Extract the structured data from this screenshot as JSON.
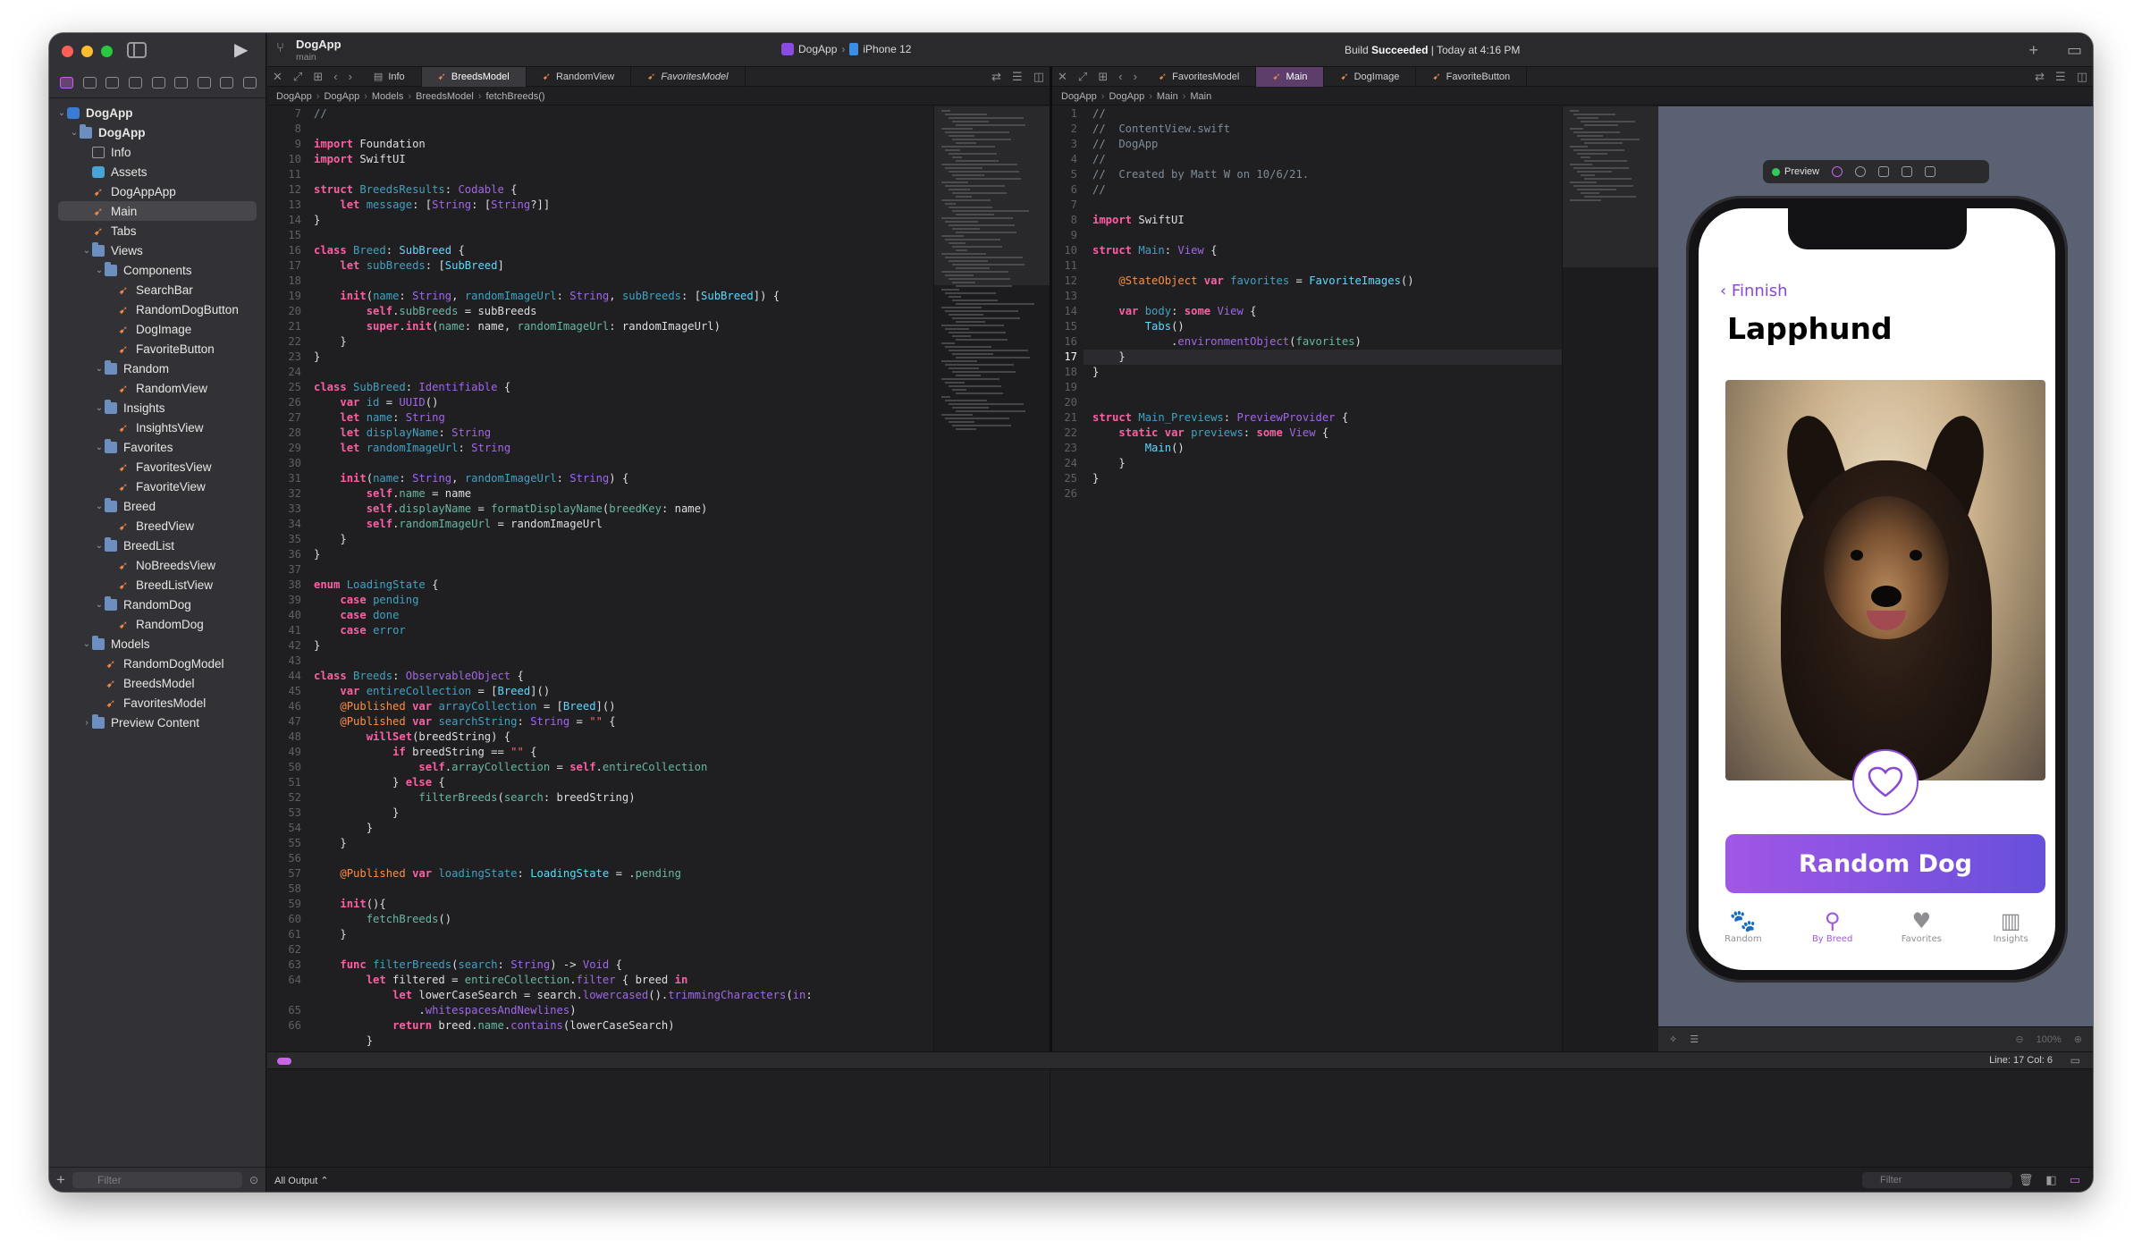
{
  "toolbar": {
    "scheme_name": "DogApp",
    "branch": "main",
    "target_app": "DogApp",
    "target_device": "iPhone 12",
    "status_prefix": "Build",
    "status_bold": "Succeeded",
    "status_suffix": "| Today at 4:16 PM"
  },
  "navigator": {
    "filter_placeholder": "Filter",
    "items": [
      {
        "label": "DogApp"
      },
      {
        "label": "DogApp"
      },
      {
        "label": "Info"
      },
      {
        "label": "Assets"
      },
      {
        "label": "DogAppApp"
      },
      {
        "label": "Main"
      },
      {
        "label": "Tabs"
      },
      {
        "label": "Views"
      },
      {
        "label": "Components"
      },
      {
        "label": "SearchBar"
      },
      {
        "label": "RandomDogButton"
      },
      {
        "label": "DogImage"
      },
      {
        "label": "FavoriteButton"
      },
      {
        "label": "Random"
      },
      {
        "label": "RandomView"
      },
      {
        "label": "Insights"
      },
      {
        "label": "InsightsView"
      },
      {
        "label": "Favorites"
      },
      {
        "label": "FavoritesView"
      },
      {
        "label": "FavoriteView"
      },
      {
        "label": "Breed"
      },
      {
        "label": "BreedView"
      },
      {
        "label": "BreedList"
      },
      {
        "label": "NoBreedsView"
      },
      {
        "label": "BreedListView"
      },
      {
        "label": "RandomDog"
      },
      {
        "label": "RandomDog"
      },
      {
        "label": "Models"
      },
      {
        "label": "RandomDogModel"
      },
      {
        "label": "BreedsModel"
      },
      {
        "label": "FavoritesModel"
      },
      {
        "label": "Preview Content"
      }
    ]
  },
  "left_tabs": [
    "Info",
    "BreedsModel",
    "RandomView",
    "FavoritesModel"
  ],
  "right_tabs": [
    "FavoritesModel",
    "Main",
    "DogImage",
    "FavoriteButton"
  ],
  "left_jump": [
    "DogApp",
    "DogApp",
    "Models",
    "BreedsModel",
    "fetchBreeds()"
  ],
  "right_jump": [
    "DogApp",
    "DogApp",
    "Main",
    "Main"
  ],
  "preview": {
    "label": "Preview",
    "back_label": "Finnish",
    "title": "Lapphund",
    "button_label": "Random Dog",
    "tabs": [
      "Random",
      "By Breed",
      "Favorites",
      "Insights"
    ],
    "zoom": "100%"
  },
  "statusbar": {
    "position": "Line: 17  Col: 6"
  },
  "debug": {
    "output_label": "All Output ⌃",
    "filter_placeholder": "Filter"
  },
  "colors": {
    "accent": "#a156e6",
    "accent2": "#6750dc",
    "swift_icon": "#f0884a"
  }
}
